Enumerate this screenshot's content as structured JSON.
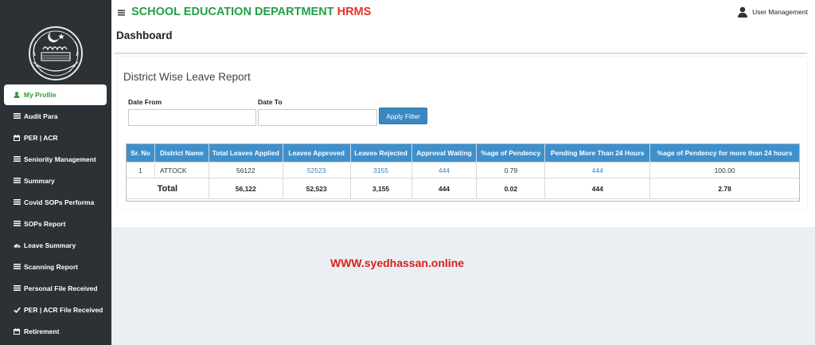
{
  "header": {
    "brand_main": "SCHOOL EDUCATION DEPARTMENT",
    "brand_suffix": "HRMS",
    "user_label": "User Management"
  },
  "sidebar": {
    "items": [
      {
        "label": "My Profile",
        "icon": "user-icon",
        "active": true
      },
      {
        "label": "Audit Para",
        "icon": "list-icon"
      },
      {
        "label": "PER | ACR",
        "icon": "calendar-icon"
      },
      {
        "label": "Seniority Management",
        "icon": "list-icon"
      },
      {
        "label": "Summary",
        "icon": "list-icon"
      },
      {
        "label": "Covid SOPs Performa",
        "icon": "list-icon"
      },
      {
        "label": "SOPs Report",
        "icon": "list-icon"
      },
      {
        "label": "Leave Summary",
        "icon": "dashboard-icon"
      },
      {
        "label": "Scanning Report",
        "icon": "list-icon"
      },
      {
        "label": "Personal File Received",
        "icon": "list-icon"
      },
      {
        "label": "PER | ACR File Received",
        "icon": "check-icon"
      },
      {
        "label": "Retirement",
        "icon": "calendar-icon"
      }
    ]
  },
  "page": {
    "title": "Dashboard"
  },
  "report": {
    "title": "District Wise Leave Report",
    "date_from_label": "Date From",
    "date_to_label": "Date To",
    "date_from_value": "",
    "date_to_value": "",
    "apply_label": "Apply Filter",
    "columns": [
      "Sr. No",
      "District Name",
      "Total Leaves Applied",
      "Leaves Approved",
      "Leaves Rejected",
      "Approval Waiting",
      "%age of Pendency",
      "Pending More Than 24 Hours",
      "%age of Pendency for more than 24 hours"
    ],
    "rows": [
      {
        "sr": "1",
        "district": "ATTOCK",
        "applied": "56122",
        "approved": "52523",
        "rejected": "3155",
        "waiting": "444",
        "pendency": "0.79",
        "pending24": "444",
        "pendency24": "100.00"
      }
    ],
    "total": {
      "label": "Total",
      "applied": "56,122",
      "approved": "52,523",
      "rejected": "3,155",
      "waiting": "444",
      "pendency": "0.02",
      "pending24": "444",
      "pendency24": "2.78"
    }
  },
  "watermark": "WWW.syedhassan.online",
  "colors": {
    "sidebar_bg": "#2c3136",
    "brand_green": "#22a046",
    "brand_red": "#e0342a",
    "table_header": "#3e90cd",
    "button_blue": "#3a88c2",
    "link_blue": "#3d7fc0"
  }
}
